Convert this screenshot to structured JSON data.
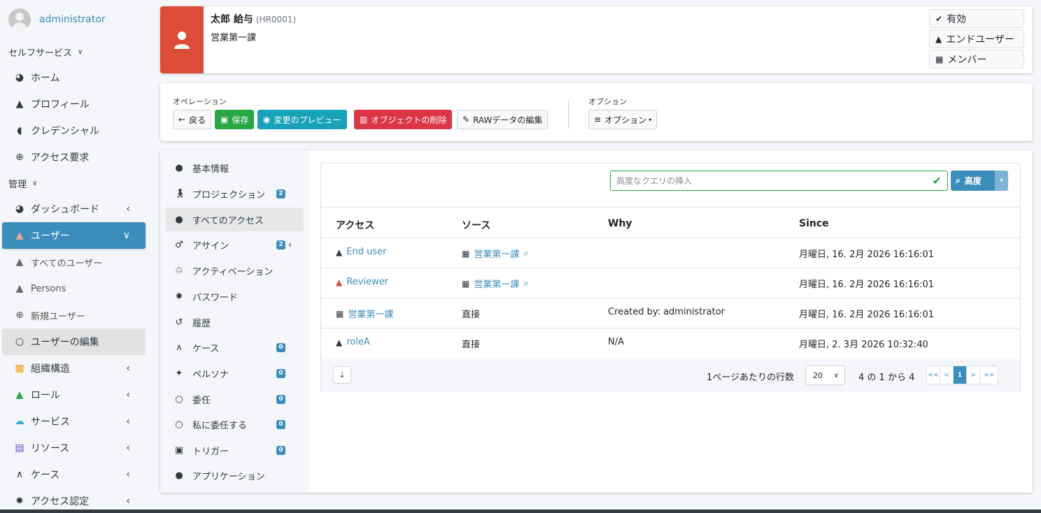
{
  "user_panel": {
    "name": "administrator"
  },
  "sidebar": {
    "selfservice_header": "セルフサービス",
    "selfservice_items": [
      {
        "label": "ホーム",
        "icon": "dashboard-icon"
      },
      {
        "label": "プロフィール",
        "icon": "user-icon"
      },
      {
        "label": "クレデンシャル",
        "icon": "shield-icon"
      },
      {
        "label": "アクセス要求",
        "icon": "plus-circle-icon"
      }
    ],
    "admin_header": "管理",
    "admin_items": [
      {
        "label": "ダッシュボード",
        "icon": "dashboard-icon"
      },
      {
        "label": "ユーザー",
        "icon": "user-icon",
        "active": true
      },
      {
        "label": "すべてのユーザー",
        "icon": "user-icon"
      },
      {
        "label": "Persons",
        "icon": "user-icon"
      },
      {
        "label": "新規ユーザー",
        "icon": "plus-circle-icon"
      },
      {
        "label": "ユーザーの編集",
        "icon": "circle-outline-icon"
      },
      {
        "label": "組織構造",
        "icon": "building-icon"
      },
      {
        "label": "ロール",
        "icon": "role-icon"
      },
      {
        "label": "サービス",
        "icon": "cloud-icon"
      },
      {
        "label": "リソース",
        "icon": "database-icon"
      },
      {
        "label": "ケース",
        "icon": "case-icon"
      },
      {
        "label": "アクセス認定",
        "icon": "certificate-icon"
      }
    ]
  },
  "header": {
    "name": "太郎 給与",
    "key": "(HR0001)",
    "department": "営業第一課",
    "status": [
      "有効",
      "エンドユーザー",
      "メンバー"
    ]
  },
  "operations": {
    "label": "オペレーション",
    "back": "戻る",
    "save": "保存",
    "preview": "変更のプレビュー",
    "delete": "オブジェクトの削除",
    "raw": "RAWデータの編集",
    "options_label": "オプション",
    "options_button": "オプション"
  },
  "tabs": [
    {
      "label": "基本情報"
    },
    {
      "label": "プロジェクション",
      "badge": "2"
    },
    {
      "label": "すべてのアクセス"
    },
    {
      "label": "アサイン",
      "badge": "2"
    },
    {
      "label": "アクティベーション"
    },
    {
      "label": "パスワード"
    },
    {
      "label": "履歴"
    },
    {
      "label": "ケース",
      "badge": "0"
    },
    {
      "label": "ペルソナ",
      "badge": "0"
    },
    {
      "label": "委任",
      "badge": "0"
    },
    {
      "label": "私に委任する",
      "badge": "0"
    },
    {
      "label": "トリガー",
      "badge": "0"
    },
    {
      "label": "アプリケーション"
    }
  ],
  "access_table": {
    "search_placeholder": "高度なクエリの挿入",
    "search_button": "高度",
    "columns": [
      "アクセス",
      "ソース",
      "Why",
      "Since"
    ],
    "rows": [
      {
        "access": "End user",
        "source": "営業第一課",
        "why": "",
        "since": "月曜日, 16. 2月 2026 16:16:01"
      },
      {
        "access": "Reviewer",
        "source": "営業第一課",
        "why": "",
        "since": "月曜日, 16. 2月 2026 16:16:01"
      },
      {
        "access": "営業第一課",
        "source": "直接",
        "why": "Created by: administrator",
        "since": "月曜日, 16. 2月 2026 16:16:01"
      },
      {
        "access": "roleA",
        "source": "直接",
        "why": "N/A",
        "since": "月曜日, 2. 3月 2026 10:32:40"
      }
    ],
    "rows_per_page_label": "1ページあたりの行数",
    "rows_per_page": "20",
    "range": "4 の 1 から 4",
    "pager": [
      "<<",
      "<",
      "1",
      ">",
      ">>"
    ]
  },
  "colors": {
    "accent": "#3c8dbc",
    "danger": "#dd4b39",
    "success": "#28a745"
  }
}
